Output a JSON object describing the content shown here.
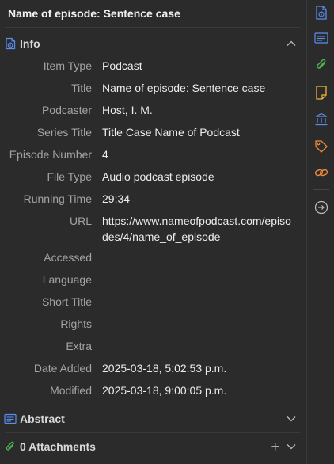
{
  "header": {
    "title": "Name of episode: Sentence case"
  },
  "info_section": {
    "label": "Info"
  },
  "fields": [
    {
      "label": "Item Type",
      "value": "Podcast"
    },
    {
      "label": "Title",
      "value": "Name of episode: Sentence case"
    },
    {
      "label": "Podcaster",
      "value": "Host, I. M."
    },
    {
      "label": "Series Title",
      "value": "Title Case Name of Podcast"
    },
    {
      "label": "Episode Number",
      "value": "4"
    },
    {
      "label": "File Type",
      "value": "Audio podcast episode"
    },
    {
      "label": "Running Time",
      "value": "29:34"
    },
    {
      "label": "URL",
      "value": "https://www.nameofpodcast.com/episodes/4/name_of_episode"
    },
    {
      "label": "Accessed",
      "value": ""
    },
    {
      "label": "Language",
      "value": ""
    },
    {
      "label": "Short Title",
      "value": ""
    },
    {
      "label": "Rights",
      "value": ""
    },
    {
      "label": "Extra",
      "value": ""
    },
    {
      "label": "Date Added",
      "value": "2025-03-18, 5:02:53 p.m."
    },
    {
      "label": "Modified",
      "value": "2025-03-18, 9:00:05 p.m."
    }
  ],
  "abstract_section": {
    "label": "Abstract"
  },
  "attachments_section": {
    "label": "0 Attachments"
  },
  "sidenav": [
    {
      "name": "info-nav-icon",
      "color": "#5b8def"
    },
    {
      "name": "abstract-nav-icon",
      "color": "#5b8def"
    },
    {
      "name": "attachments-nav-icon",
      "color": "#4caf50"
    },
    {
      "name": "notes-nav-icon",
      "color": "#f2b33a"
    },
    {
      "name": "libraries-collections-nav-icon",
      "color": "#5b8def"
    },
    {
      "name": "tags-nav-icon",
      "color": "#f08a3c"
    },
    {
      "name": "related-nav-icon",
      "color": "#f08a3c"
    },
    {
      "name": "locate-nav-icon",
      "color": "#bdbdbd"
    }
  ]
}
